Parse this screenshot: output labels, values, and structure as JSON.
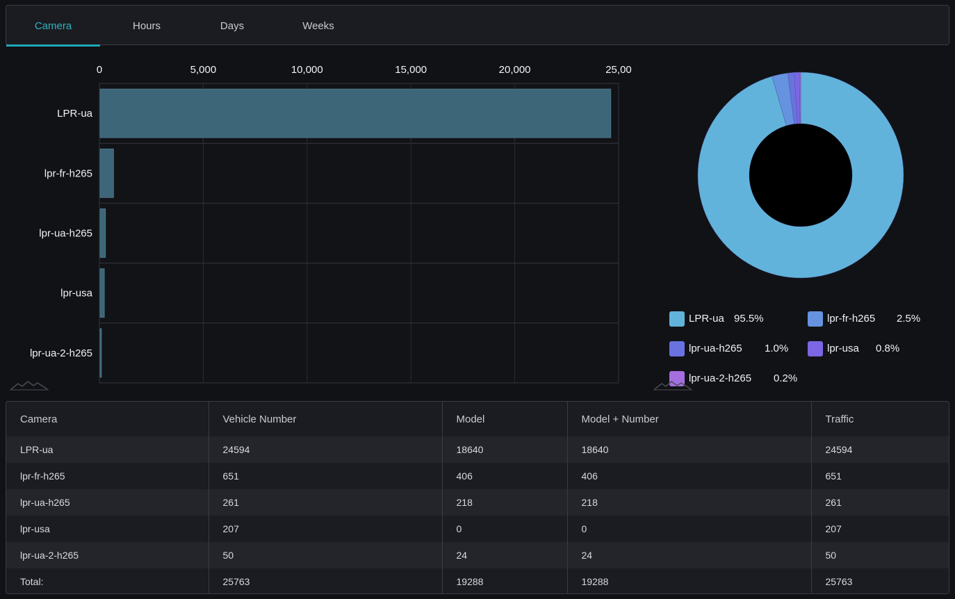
{
  "tabs": [
    {
      "label": "Camera",
      "active": true
    },
    {
      "label": "Hours",
      "active": false
    },
    {
      "label": "Days",
      "active": false
    },
    {
      "label": "Weeks",
      "active": false
    }
  ],
  "chart_data": [
    {
      "type": "bar",
      "orientation": "horizontal",
      "categories": [
        "LPR-ua",
        "lpr-fr-h265",
        "lpr-ua-h265",
        "lpr-usa",
        "lpr-ua-2-h265"
      ],
      "values": [
        24594,
        651,
        261,
        207,
        50
      ],
      "x_ticks": [
        "0",
        "5,000",
        "10,000",
        "15,000",
        "20,000",
        "25,00"
      ],
      "xlim": [
        0,
        25000
      ],
      "grid": true,
      "color": "#3e6679"
    },
    {
      "type": "pie",
      "donut": true,
      "labels": [
        "LPR-ua",
        "lpr-fr-h265",
        "lpr-ua-h265",
        "lpr-usa",
        "lpr-ua-2-h265"
      ],
      "values": [
        95.5,
        2.5,
        1.0,
        0.8,
        0.2
      ],
      "percent_labels": [
        "95.5%",
        "2.5%",
        "1.0%",
        "0.8%",
        "0.2%"
      ],
      "colors": [
        "#62b3db",
        "#6593e0",
        "#6a72e0",
        "#7d66e3",
        "#a56ee0"
      ],
      "legend_position": "bottom"
    }
  ],
  "table": {
    "headers": [
      "Camera",
      "Vehicle Number",
      "Model",
      "Model + Number",
      "Traffic"
    ],
    "rows": [
      [
        "LPR-ua",
        "24594",
        "18640",
        "18640",
        "24594"
      ],
      [
        "lpr-fr-h265",
        "651",
        "406",
        "406",
        "651"
      ],
      [
        "lpr-ua-h265",
        "261",
        "218",
        "218",
        "261"
      ],
      [
        "lpr-usa",
        "207",
        "0",
        "0",
        "207"
      ],
      [
        "lpr-ua-2-h265",
        "50",
        "24",
        "24",
        "50"
      ],
      [
        "Total:",
        "25763",
        "19288",
        "19288",
        "25763"
      ]
    ]
  }
}
